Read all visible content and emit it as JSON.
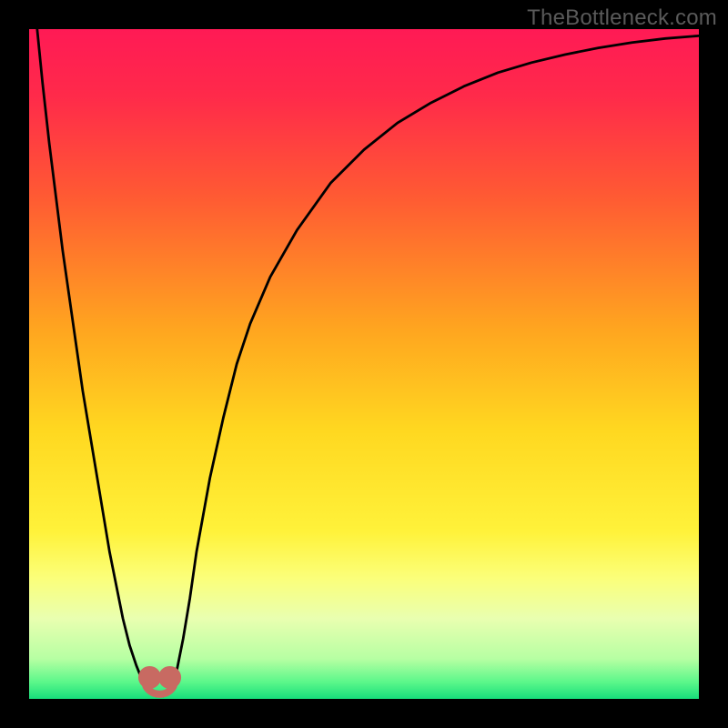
{
  "watermark": "TheBottleneck.com",
  "chart_data": {
    "type": "line",
    "title": "",
    "xlabel": "",
    "ylabel": "",
    "xlim": [
      0,
      100
    ],
    "ylim": [
      0,
      100
    ],
    "grid": false,
    "background_gradient": {
      "stops": [
        {
          "offset": 0.0,
          "color": "#ff1a55"
        },
        {
          "offset": 0.1,
          "color": "#ff2a4a"
        },
        {
          "offset": 0.25,
          "color": "#ff5a33"
        },
        {
          "offset": 0.45,
          "color": "#ffa61f"
        },
        {
          "offset": 0.6,
          "color": "#ffd820"
        },
        {
          "offset": 0.75,
          "color": "#fff23a"
        },
        {
          "offset": 0.82,
          "color": "#fbff7a"
        },
        {
          "offset": 0.88,
          "color": "#e9ffb0"
        },
        {
          "offset": 0.94,
          "color": "#b7ffa3"
        },
        {
          "offset": 0.975,
          "color": "#5bf78a"
        },
        {
          "offset": 1.0,
          "color": "#17de7b"
        }
      ]
    },
    "series": [
      {
        "name": "bottleneck-curve",
        "stroke": "#000000",
        "stroke_width": 2.8,
        "x": [
          0,
          1,
          2,
          3,
          4,
          5,
          6,
          7,
          8,
          9,
          10,
          11,
          12,
          13,
          14,
          15,
          16,
          17,
          18,
          19,
          20,
          21,
          22,
          23,
          24,
          25,
          27,
          29,
          31,
          33,
          36,
          40,
          45,
          50,
          55,
          60,
          65,
          70,
          75,
          80,
          85,
          90,
          95,
          100
        ],
        "y": [
          112,
          102,
          92,
          83,
          75,
          67,
          60,
          53,
          46,
          40,
          34,
          28,
          22,
          17,
          12,
          8,
          5,
          2.5,
          1,
          0.4,
          0.4,
          1.2,
          4,
          9,
          15,
          22,
          33,
          42,
          50,
          56,
          63,
          70,
          77,
          82,
          86,
          89,
          91.5,
          93.5,
          95,
          96.2,
          97.2,
          98,
          98.6,
          99
        ]
      }
    ],
    "markers": [
      {
        "name": "valley-left",
        "x": 18.0,
        "y": 3.2,
        "r": 1.7,
        "color": "#c86a62"
      },
      {
        "name": "valley-right",
        "x": 21.0,
        "y": 3.2,
        "r": 1.7,
        "color": "#c86a62"
      }
    ],
    "valley_arc": {
      "cx": 19.5,
      "cy": 2.6,
      "rx": 2.2,
      "ry": 1.9,
      "stroke": "#c86a62",
      "stroke_width": 8
    }
  }
}
